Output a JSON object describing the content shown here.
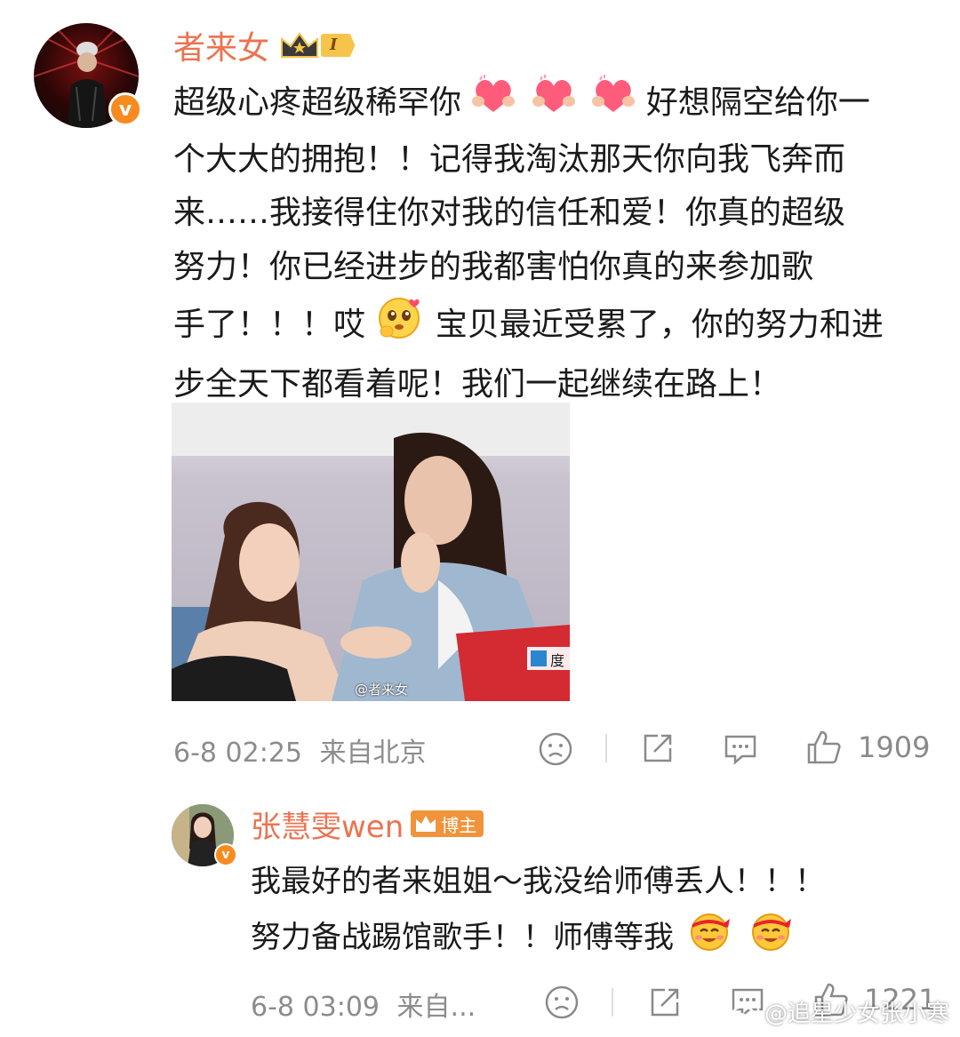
{
  "comment1": {
    "username": "者来女",
    "level": "I",
    "text_lines": [
      "超级心疼超级稀罕你",
      "好想隔空给你一",
      "个大大的拥抱！！记得我淘汰那天你向我飞奔而",
      "来……我接得住你对我的信任和爱！你真的超级",
      "努力！你已经进步的我都害怕你真的来参加歌",
      "手了！！！哎",
      "宝贝最近受累了，你的努力和进",
      "步全天下都看着呢！我们一起继续在路上！"
    ],
    "photo_watermark": "@者来女",
    "photo_logo_text": "度",
    "time": "6-8 02:25",
    "location": "来自北京",
    "likes": "1909"
  },
  "comment2": {
    "username": "张慧雯wen",
    "tag": "博主",
    "text_lines": [
      "我最好的者来姐姐～我没给师傅丢人！！！",
      "努力备战踢馆歌手！！师傅等我"
    ],
    "time": "6-8 03:09",
    "location": "来自...",
    "likes": "1221"
  },
  "watermark": "@追星少女张小寒",
  "colors": {
    "username": "#eb7350",
    "meta": "#8c8c8c",
    "verified": "#f78b1f"
  }
}
